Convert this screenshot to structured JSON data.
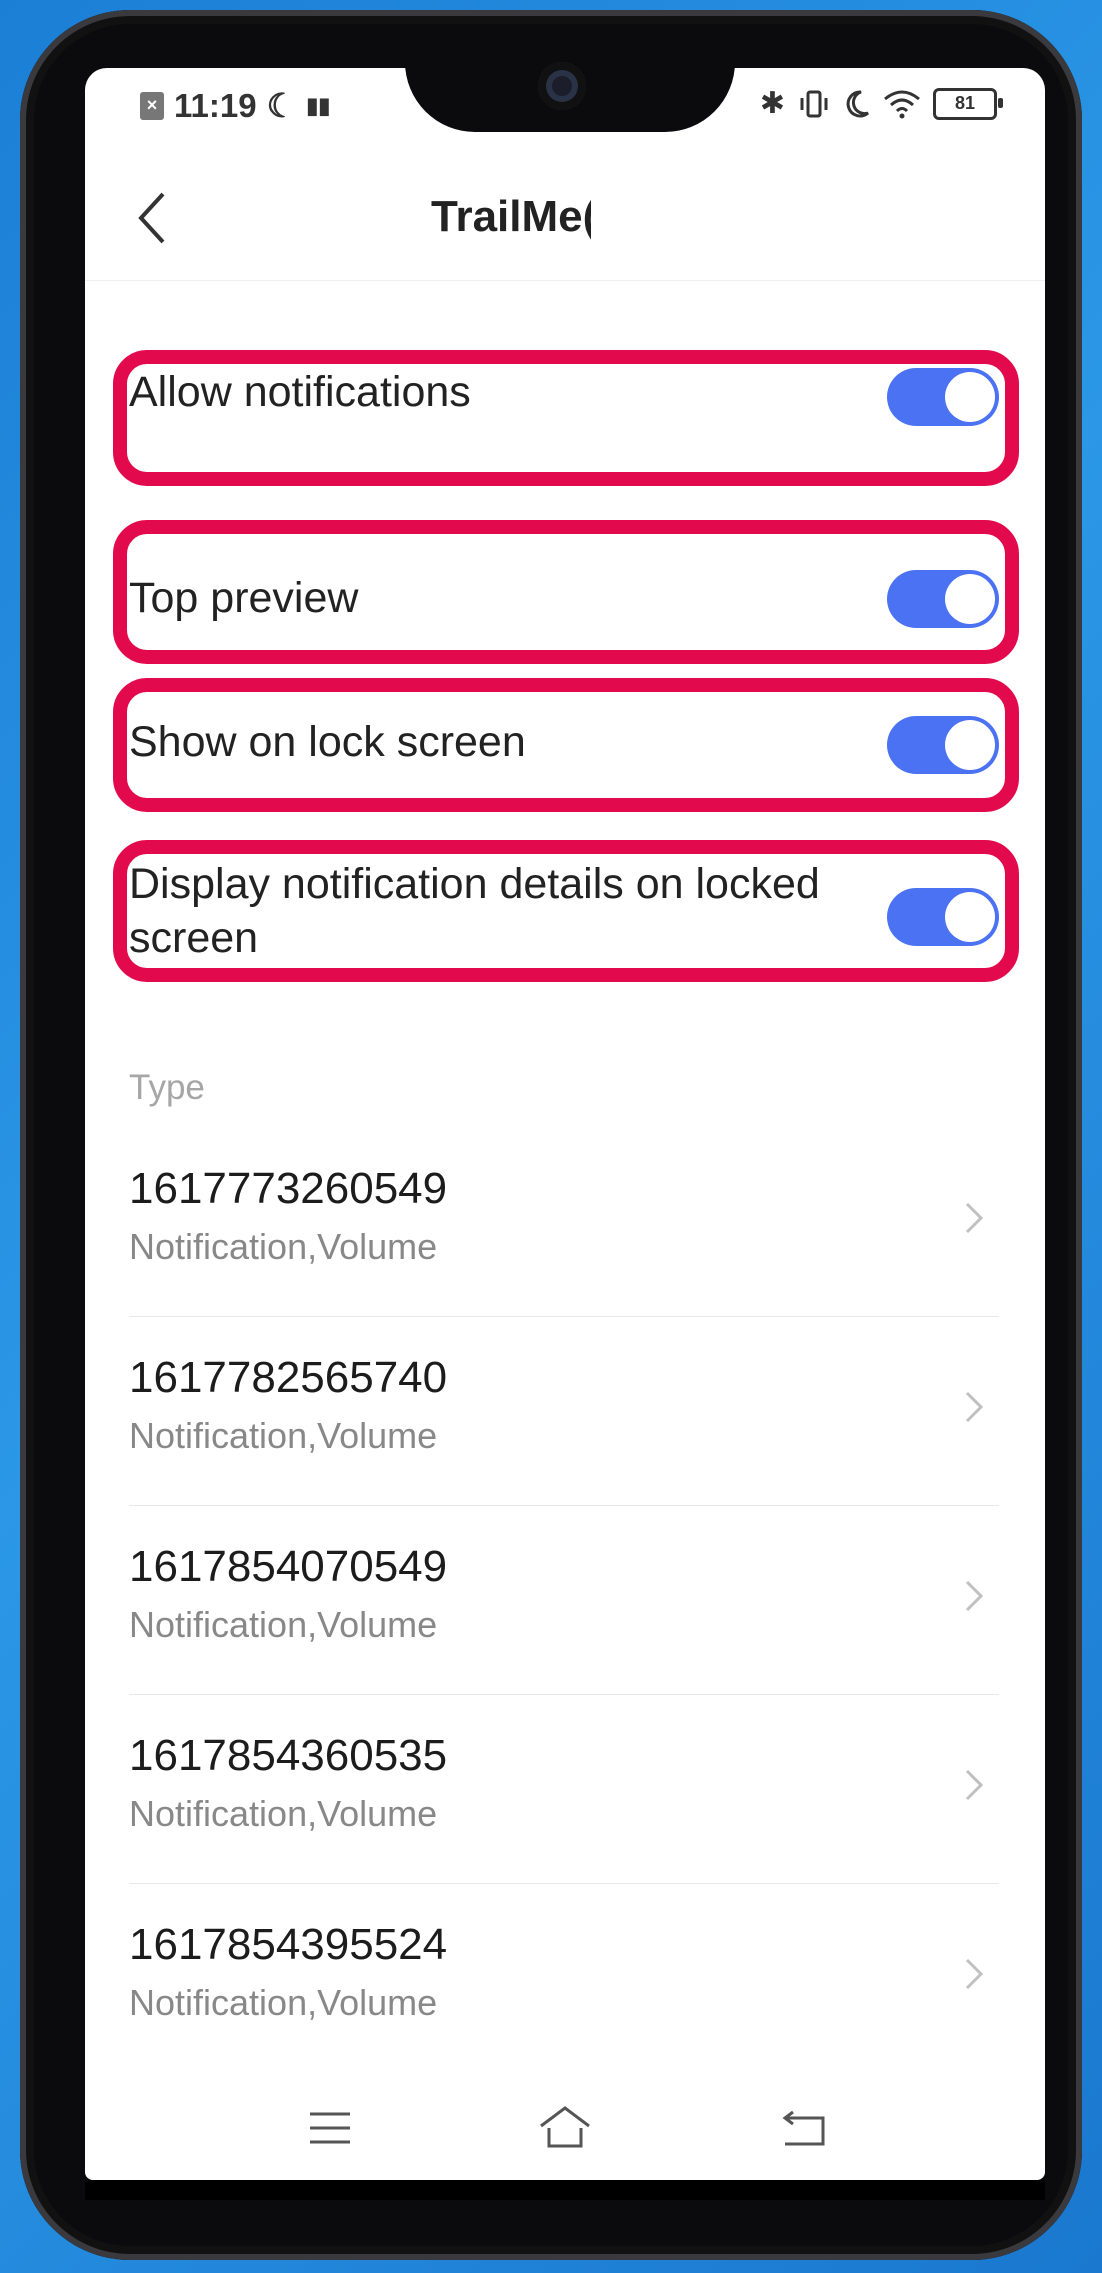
{
  "status_bar": {
    "time": "11:19",
    "notif_box": "×",
    "moon": "☾",
    "book": "▮▮",
    "bt": "✱",
    "battery": "81"
  },
  "header": {
    "title": "TrailMe("
  },
  "toggles": [
    {
      "label": "Allow notifications",
      "on": true
    },
    {
      "label": "Top preview",
      "on": true
    },
    {
      "label": "Show on lock screen",
      "on": true
    },
    {
      "label": "Display notification details on locked screen",
      "on": true
    }
  ],
  "section": {
    "type_label": "Type"
  },
  "channels": [
    {
      "id": "1617773260549",
      "sub": "Notification,Volume"
    },
    {
      "id": "1617782565740",
      "sub": "Notification,Volume"
    },
    {
      "id": "1617854070549",
      "sub": "Notification,Volume"
    },
    {
      "id": "1617854360535",
      "sub": "Notification,Volume"
    },
    {
      "id": "1617854395524",
      "sub": "Notification,Volume"
    }
  ],
  "colors": {
    "highlight": "#e20a4c",
    "toggle_on": "#4a72f3",
    "background": "#1c7fd6"
  },
  "icons": {
    "back": "chevron-left-icon",
    "chevron": "chevron-right-icon",
    "menu": "menu-icon",
    "home": "home-icon",
    "back_nav": "back-icon"
  }
}
